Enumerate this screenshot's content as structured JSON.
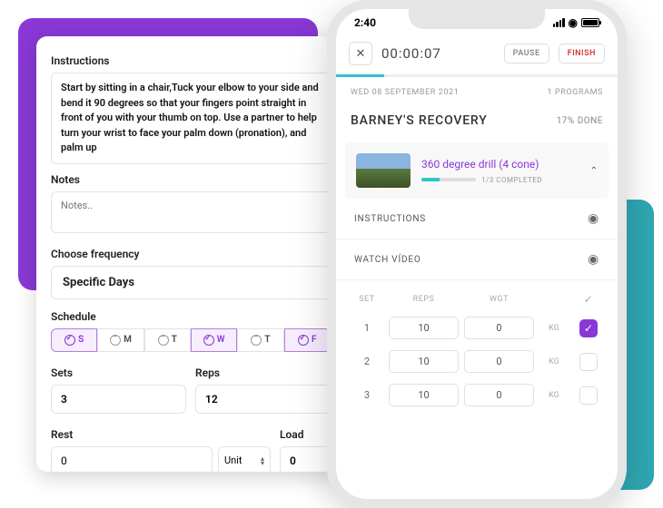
{
  "left": {
    "instructions_label": "Instructions",
    "instructions_text": "Start by sitting in a chair,Tuck your elbow to your side and bend it 90 degrees so that your fingers point straight in front of you with your thumb on top. Use a partner to help turn your wrist to face your palm down (pronation), and palm up",
    "notes_label": "Notes",
    "notes_placeholder": "Notes..",
    "freq_label": "Choose frequency",
    "freq_value": "Specific Days",
    "schedule_label": "Schedule",
    "days": [
      {
        "abbr": "S",
        "on": true
      },
      {
        "abbr": "M",
        "on": false
      },
      {
        "abbr": "T",
        "on": false
      },
      {
        "abbr": "W",
        "on": true
      },
      {
        "abbr": "T",
        "on": false
      },
      {
        "abbr": "F",
        "on": true
      }
    ],
    "sets_label": "Sets",
    "sets_value": "3",
    "reps_label": "Reps",
    "reps_value": "12",
    "rest_label": "Rest",
    "rest_value": "0",
    "unit_label": "Unit",
    "load_label": "Load",
    "load_value": "0"
  },
  "phone": {
    "time": "2:40",
    "timer": "00:00:07",
    "pause": "PAUSE",
    "finish": "FINISH",
    "date": "WED 08 SEPTEMBER 2021",
    "programs": "1 PROGRAMS",
    "title": "BARNEY'S RECOVERY",
    "done": "17% DONE",
    "exercise": "360 degree drill (4 cone)",
    "completed": "1/3 COMPLETED",
    "instructions": "INSTRUCTIONS",
    "watch": "WATCH VÍDEO",
    "headers": {
      "set": "SET",
      "reps": "REPS",
      "wgt": "WGT"
    },
    "rows": [
      {
        "n": "1",
        "reps": "10",
        "wgt": "0",
        "unit": "KG",
        "done": true
      },
      {
        "n": "2",
        "reps": "10",
        "wgt": "0",
        "unit": "KG",
        "done": false
      },
      {
        "n": "3",
        "reps": "10",
        "wgt": "0",
        "unit": "KG",
        "done": false
      }
    ]
  }
}
